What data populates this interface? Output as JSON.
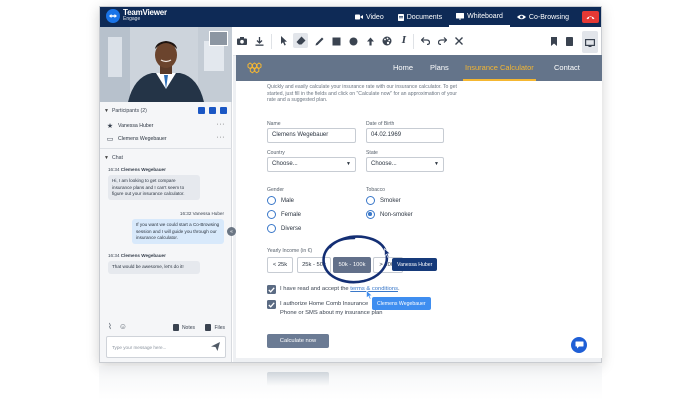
{
  "app": {
    "name": "TeamViewer",
    "subtitle": "Engage"
  },
  "topbar": {
    "actions": [
      {
        "label": "Video",
        "active": false
      },
      {
        "label": "Documents",
        "active": false
      },
      {
        "label": "Whiteboard",
        "active": true
      },
      {
        "label": "Co-Browsing",
        "active": false
      }
    ],
    "end_call_icon": "phone-hangup-icon",
    "colors": {
      "bar": "#0e2a56",
      "end_call": "#e53935"
    }
  },
  "participants": {
    "heading": "Participants (2)",
    "list": [
      {
        "name": "Vanessa Huber",
        "icon": "star-icon"
      },
      {
        "name": "Clemens Wegebauer",
        "icon": "monitor-icon"
      }
    ]
  },
  "chat": {
    "heading": "Chat",
    "messages": [
      {
        "time": "16:34",
        "author": "Clemens Wegebauer",
        "text": "Hi, I am looking to get compare insurance plans and I can't seem to figure out your insurance calculator.",
        "direction": "in"
      },
      {
        "time": "16:32",
        "author": "Vanessa Huber",
        "text": "If you want we could start a Co-Browsing session and I will guide you through our insurance calculator.",
        "direction": "out"
      },
      {
        "time": "16:34",
        "author": "Clemens Wegebauer",
        "text": "That would be awesome, let's do it!",
        "direction": "in"
      }
    ],
    "notes_label": "Notes",
    "files_label": "Files",
    "input_placeholder": "Type your message here..."
  },
  "site": {
    "nav": [
      {
        "label": "Home",
        "active": false
      },
      {
        "label": "Plans",
        "active": false
      },
      {
        "label": "Insurance Calculator",
        "active": true
      },
      {
        "label": "Contact",
        "active": false
      }
    ],
    "intro": "Quickly and easily calculate your insurance rate with our insurance calculator. To get started, just fill in the fields and click on \"Calculate now\" for an approximation of your rate and a suggested plan.",
    "form": {
      "name_label": "Name",
      "name_value": "Clemens Wegebauer",
      "dob_label": "Date of Birth",
      "dob_value": "04.02.1969",
      "country_label": "Country",
      "country_value": "Choose...",
      "state_label": "State",
      "state_value": "Choose...",
      "gender_label": "Gender",
      "gender_options": [
        {
          "label": "Male",
          "selected": false
        },
        {
          "label": "Female",
          "selected": false
        },
        {
          "label": "Diverse",
          "selected": false
        }
      ],
      "tobacco_label": "Tobacco",
      "tobacco_options": [
        {
          "label": "Smoker",
          "selected": false
        },
        {
          "label": "Non-smoker",
          "selected": true
        }
      ],
      "income_label": "Yearly Income (in €)",
      "income_options": [
        {
          "label": "< 25k",
          "selected": false
        },
        {
          "label": "25k - 50k",
          "selected": false
        },
        {
          "label": "50k - 100k",
          "selected": true
        },
        {
          "label": "> 100k",
          "selected": false
        }
      ],
      "terms_text": "I have read and accept the",
      "terms_link": "terms & conditions",
      "terms_end": ".",
      "consent_text_1": "I authorize Home Comb Insurance",
      "consent_text_2": "Phone or SMS about my insurance plan",
      "submit_label": "Calculate now"
    },
    "colors": {
      "nav": "#64748a",
      "accent": "#f5b731",
      "primary": "#3a78c9"
    }
  },
  "cursors": [
    {
      "name": "Vanessa Huber",
      "color": "#163a7a"
    },
    {
      "name": "Clemens Wegebauer",
      "color": "#3f8ef0"
    }
  ]
}
